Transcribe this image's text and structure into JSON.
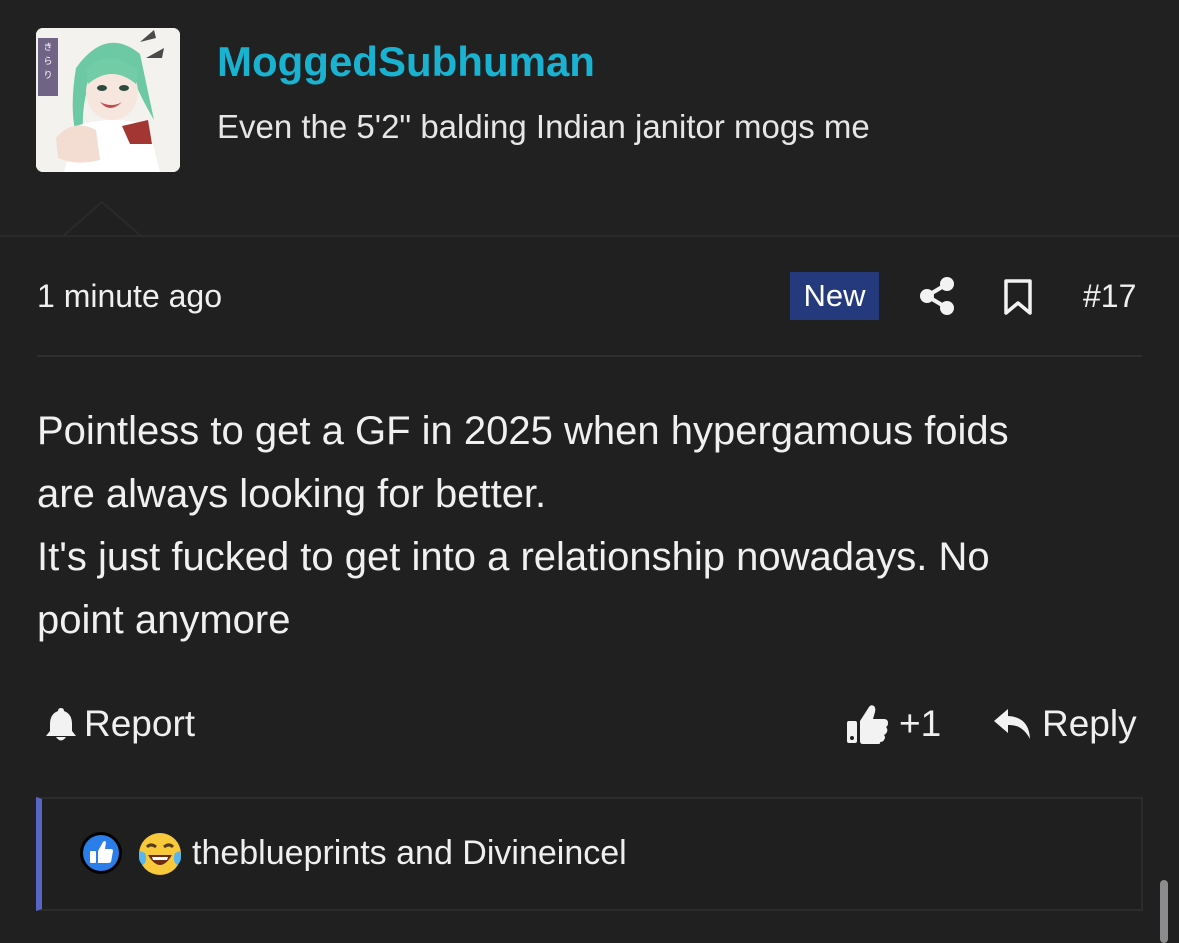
{
  "post": {
    "author": {
      "username": "MoggedSubhuman",
      "user_title": "Even the 5'2\" balding Indian janitor mogs me",
      "avatar_icon": "anime-avatar-image",
      "username_color": "#1ab2d1"
    },
    "meta": {
      "time": "1 minute ago",
      "new_badge": "New",
      "post_number": "#17",
      "share_icon": "share-icon",
      "bookmark_icon": "bookmark-icon"
    },
    "body": {
      "lines": [
        "Pointless to get a GF in 2025 when hypergamous foids",
        "are always looking for better.",
        "It's just fucked to get into a relationship nowadays. No",
        "point anymore"
      ]
    },
    "actions": {
      "report_label": "Report",
      "like_count": "+1",
      "reply_label": "Reply"
    },
    "reactions": {
      "icons": [
        "like-reaction-icon",
        "laugh-reaction-icon"
      ],
      "text": "theblueprints and Divineincel"
    }
  },
  "colors": {
    "background": "#202021",
    "new_badge": "#253a7d",
    "reaction_accent": "#5865c6"
  }
}
